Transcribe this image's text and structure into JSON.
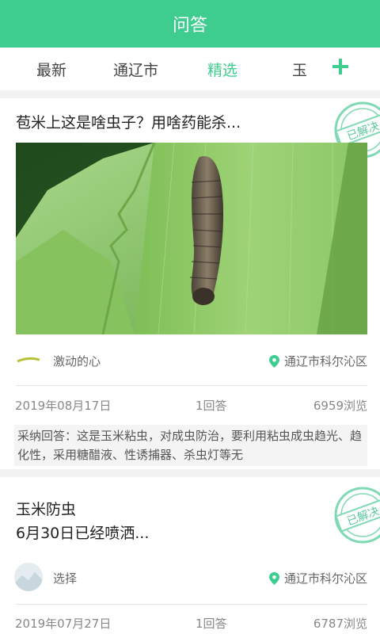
{
  "header": {
    "title": "问答"
  },
  "tabs": [
    {
      "label": "最新",
      "active": false
    },
    {
      "label": "通辽市",
      "active": false
    },
    {
      "label": "精选",
      "active": true
    },
    {
      "label": "玉",
      "active": false
    }
  ],
  "colors": {
    "accent": "#3fcc8f",
    "stamp": "#7fd9b2"
  },
  "questions": [
    {
      "title": "苞米上这是啥虫子？用啥药能杀...",
      "stamp_text": "已解决",
      "user": "激动的心",
      "location": "通辽市科尔沁区",
      "date": "2019年08月17日",
      "answers": "1回答",
      "views": "6959浏览",
      "adopted_answer": "采纳回答：这是玉米粘虫，对成虫防治，要利用粘虫成虫趋光、趋化性，采用糖醋液、性诱捕器、杀虫灯等无"
    },
    {
      "title_line1": "玉米防虫",
      "title_line2": "6月30日已经喷洒...",
      "stamp_text": "已解决",
      "user": "选择",
      "location": "通辽市科尔沁区",
      "date": "2019年07月27日",
      "answers": "1回答",
      "views": "6787浏览"
    }
  ]
}
